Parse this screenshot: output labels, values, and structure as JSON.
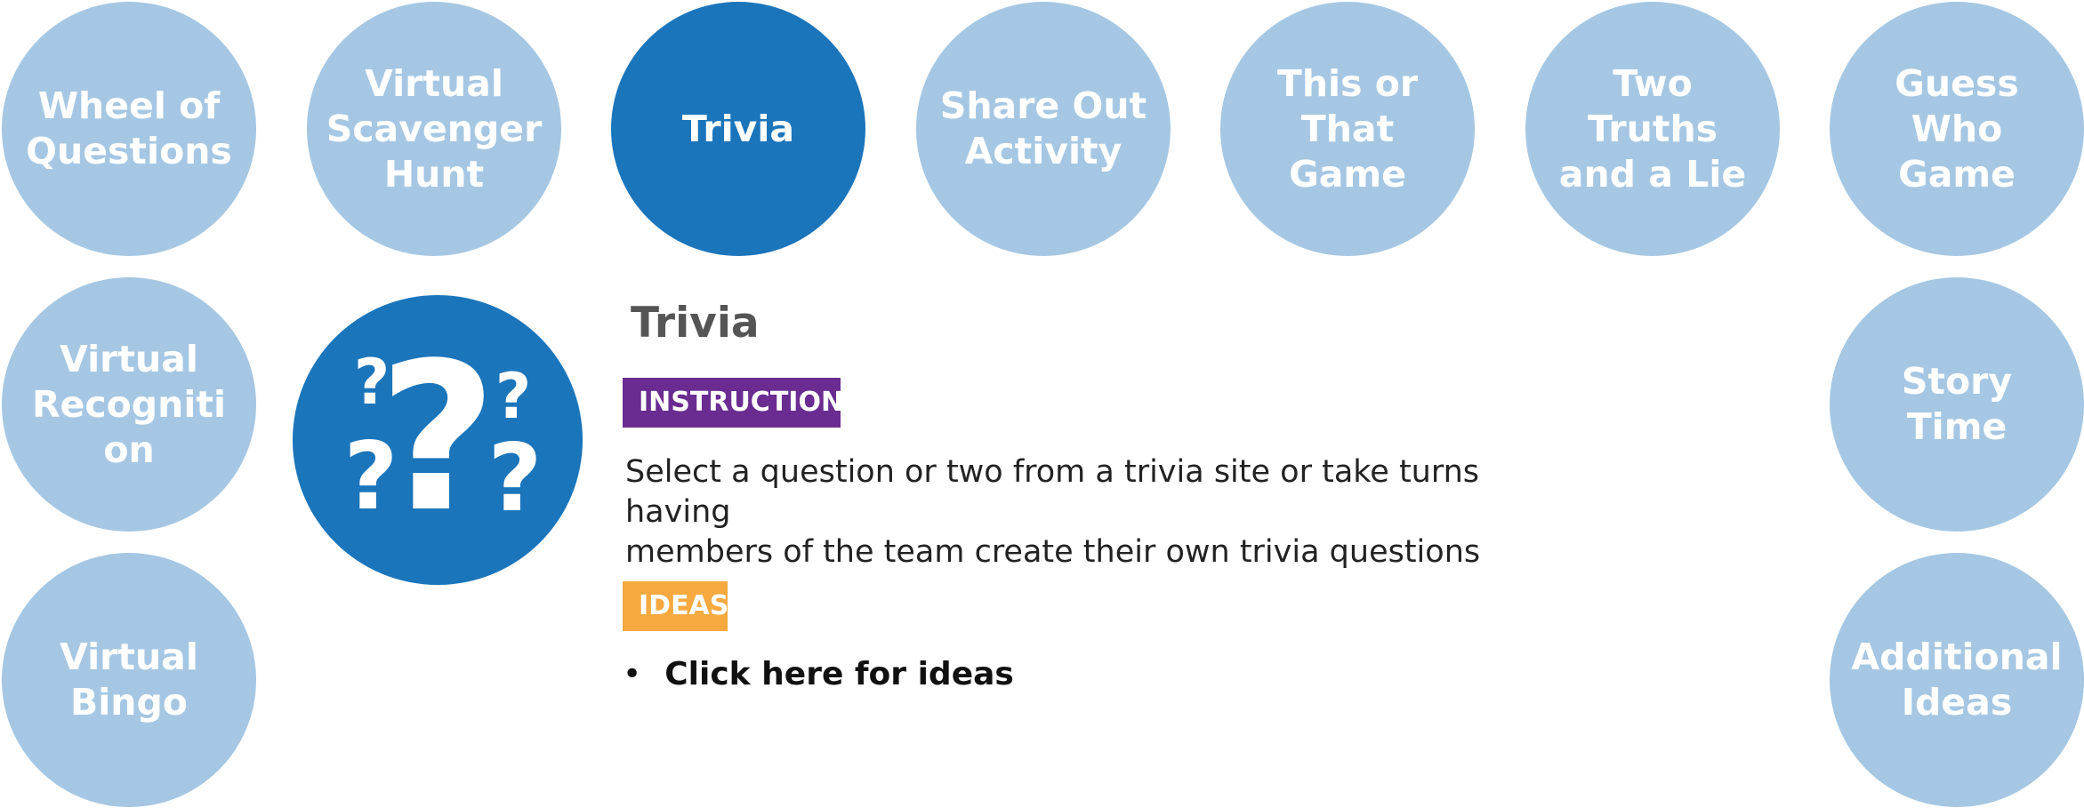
{
  "nav": {
    "wheel": [
      "Wheel of",
      "Questions"
    ],
    "scavenger": [
      "Virtual",
      "Scavenger",
      "Hunt"
    ],
    "trivia": [
      "Trivia"
    ],
    "shareout": [
      "Share Out",
      "Activity"
    ],
    "thisorthat": [
      "This or",
      "That",
      "Game"
    ],
    "twotruths": [
      "Two Truths",
      "and a Lie"
    ],
    "guesswho": [
      "Guess",
      "Who",
      "Game"
    ],
    "recognition": [
      "Virtual",
      "Recogniti",
      "on"
    ],
    "storytime": [
      "Story Time"
    ],
    "bingo": [
      "Virtual",
      "Bingo"
    ],
    "additional": [
      "Additional",
      "Ideas"
    ]
  },
  "content": {
    "title": "Trivia",
    "instructions_label": "INSTRUCTIONS",
    "description_lines": [
      "Select a question or two from a trivia site or take turns having",
      "members of the team create their own trivia questions"
    ],
    "ideas_label": "IDEAS",
    "bullet": "•",
    "ideas_link": "Click here for ideas"
  },
  "colors": {
    "circle_inactive": "#a5c7e3",
    "circle_active": "#1b75bb",
    "instructions_tag": "#6a2c91",
    "ideas_tag": "#f5a93f",
    "title": "#555555"
  },
  "icon": "question-marks-icon"
}
